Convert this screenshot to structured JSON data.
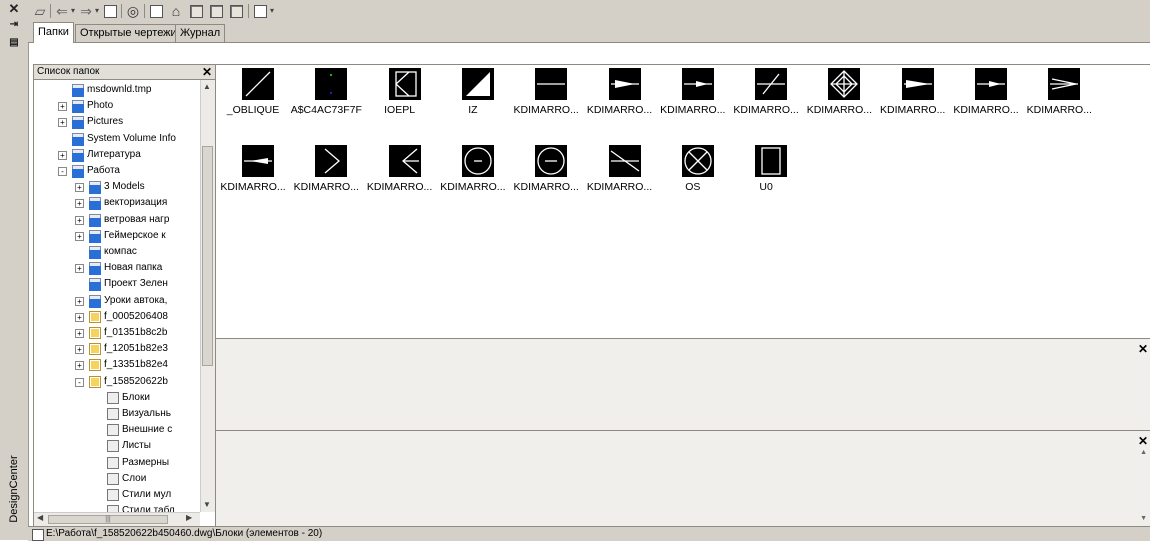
{
  "palette": {
    "title": "DesignCenter",
    "close_icon": "close-icon",
    "autohide_icon": "autohide-icon",
    "properties_icon": "properties-icon"
  },
  "toolbar": {
    "buttons": [
      "load",
      "back",
      "forward",
      "up",
      "search",
      "favorites",
      "home",
      "tree-toggle",
      "preview",
      "description",
      "views"
    ]
  },
  "tabs": [
    "Папки",
    "Открытые чертежи",
    "Журнал"
  ],
  "tree": {
    "header": "Список папок",
    "rows": [
      {
        "label": "msdownld.tmp",
        "icon": "folder",
        "level": 1,
        "expander": ""
      },
      {
        "label": "Photo",
        "icon": "folder",
        "level": 1,
        "expander": "+"
      },
      {
        "label": "Pictures",
        "icon": "folder",
        "level": 1,
        "expander": "+"
      },
      {
        "label": "System Volume Info",
        "icon": "folder",
        "level": 1,
        "expander": ""
      },
      {
        "label": "Литература",
        "icon": "folder",
        "level": 1,
        "expander": "+"
      },
      {
        "label": "Работа",
        "icon": "folder",
        "level": 1,
        "expander": "-"
      },
      {
        "label": "3 Models",
        "icon": "folder",
        "level": 2,
        "expander": "+"
      },
      {
        "label": "векторизация",
        "icon": "folder",
        "level": 2,
        "expander": "+"
      },
      {
        "label": "ветровая нагр",
        "icon": "folder",
        "level": 2,
        "expander": "+"
      },
      {
        "label": "Геймерское к",
        "icon": "folder",
        "level": 2,
        "expander": "+"
      },
      {
        "label": "компас",
        "icon": "folder",
        "level": 2,
        "expander": ""
      },
      {
        "label": "Новая папка",
        "icon": "folder",
        "level": 2,
        "expander": "+"
      },
      {
        "label": "Проект Зелен",
        "icon": "folder",
        "level": 2,
        "expander": ""
      },
      {
        "label": "Уроки автока,",
        "icon": "folder",
        "level": 2,
        "expander": "+"
      },
      {
        "label": "f_0005206408",
        "icon": "dwg",
        "level": 2,
        "expander": "+"
      },
      {
        "label": "f_01351b8c2b",
        "icon": "dwg",
        "level": 2,
        "expander": "+"
      },
      {
        "label": "f_12051b82e3",
        "icon": "dwg",
        "level": 2,
        "expander": "+"
      },
      {
        "label": "f_13351b82e4",
        "icon": "dwg",
        "level": 2,
        "expander": "+"
      },
      {
        "label": "f_158520622b",
        "icon": "dwg",
        "level": 2,
        "expander": "-"
      },
      {
        "label": "Блоки",
        "icon": "sub",
        "level": 3,
        "expander": ""
      },
      {
        "label": "Визуальнь",
        "icon": "sub",
        "level": 3,
        "expander": ""
      },
      {
        "label": "Внешние с",
        "icon": "sub",
        "level": 3,
        "expander": ""
      },
      {
        "label": "Листы",
        "icon": "sub",
        "level": 3,
        "expander": ""
      },
      {
        "label": "Размерны",
        "icon": "sub",
        "level": 3,
        "expander": ""
      },
      {
        "label": "Слои",
        "icon": "sub",
        "level": 3,
        "expander": ""
      },
      {
        "label": "Стили мул",
        "icon": "sub",
        "level": 3,
        "expander": ""
      },
      {
        "label": "Стили табл",
        "icon": "sub",
        "level": 3,
        "expander": ""
      }
    ]
  },
  "blocks": [
    {
      "label": "_OBLIQUE",
      "shape": "oblique"
    },
    {
      "label": "A$C4AC73F7F",
      "shape": "dots"
    },
    {
      "label": "IOEPL",
      "shape": "ioepl"
    },
    {
      "label": "IZ",
      "shape": "iz"
    },
    {
      "label": "KDIMARRO...",
      "shape": "hline"
    },
    {
      "label": "KDIMARRO...",
      "shape": "arrow-right"
    },
    {
      "label": "KDIMARRO...",
      "shape": "arrow-small"
    },
    {
      "label": "KDIMARRO...",
      "shape": "tick"
    },
    {
      "label": "KDIMARRO...",
      "shape": "diamond"
    },
    {
      "label": "KDIMARRO...",
      "shape": "arrow-fill"
    },
    {
      "label": "KDIMARRO...",
      "shape": "arrow-small"
    },
    {
      "label": "KDIMARRO...",
      "shape": "arrow-open"
    },
    {
      "label": "KDIMARRO...",
      "shape": "arrow-left"
    },
    {
      "label": "KDIMARRO...",
      "shape": "chevron-right"
    },
    {
      "label": "KDIMARRO...",
      "shape": "chevron-left"
    },
    {
      "label": "KDIMARRO...",
      "shape": "circle-dot"
    },
    {
      "label": "KDIMARRO...",
      "shape": "circle-line"
    },
    {
      "label": "KDIMARRO...",
      "shape": "tri-right"
    },
    {
      "label": "OS",
      "shape": "circle-x"
    },
    {
      "label": "U0",
      "shape": "rect"
    }
  ],
  "status": {
    "text": "E:\\Работа\\f_158520622b450460.dwg\\Блоки (элементов - 20)"
  }
}
